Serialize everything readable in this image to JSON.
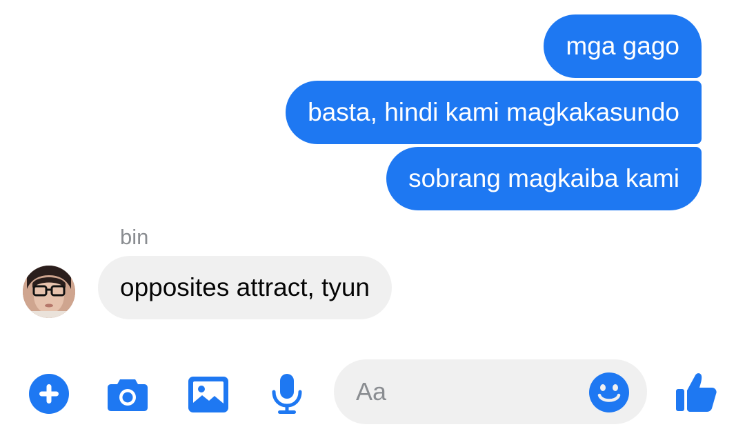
{
  "conversation": {
    "outgoing": [
      {
        "text": "mga gago"
      },
      {
        "text": "basta, hindi kami magkakasundo"
      },
      {
        "text": "sobrang magkaiba kami"
      }
    ],
    "incoming": {
      "sender": "bin",
      "text": "opposites attract, tyun"
    }
  },
  "composer": {
    "placeholder": "Aa"
  },
  "toolbar": {
    "icons": [
      "plus-circle-icon",
      "camera-icon",
      "photo-icon",
      "microphone-icon",
      "emoji-icon",
      "thumbs-up-icon"
    ]
  },
  "colors": {
    "accent": "#1e78f2",
    "incoming_bubble": "#f0f0f0",
    "secondary_text": "#8a8d91"
  }
}
